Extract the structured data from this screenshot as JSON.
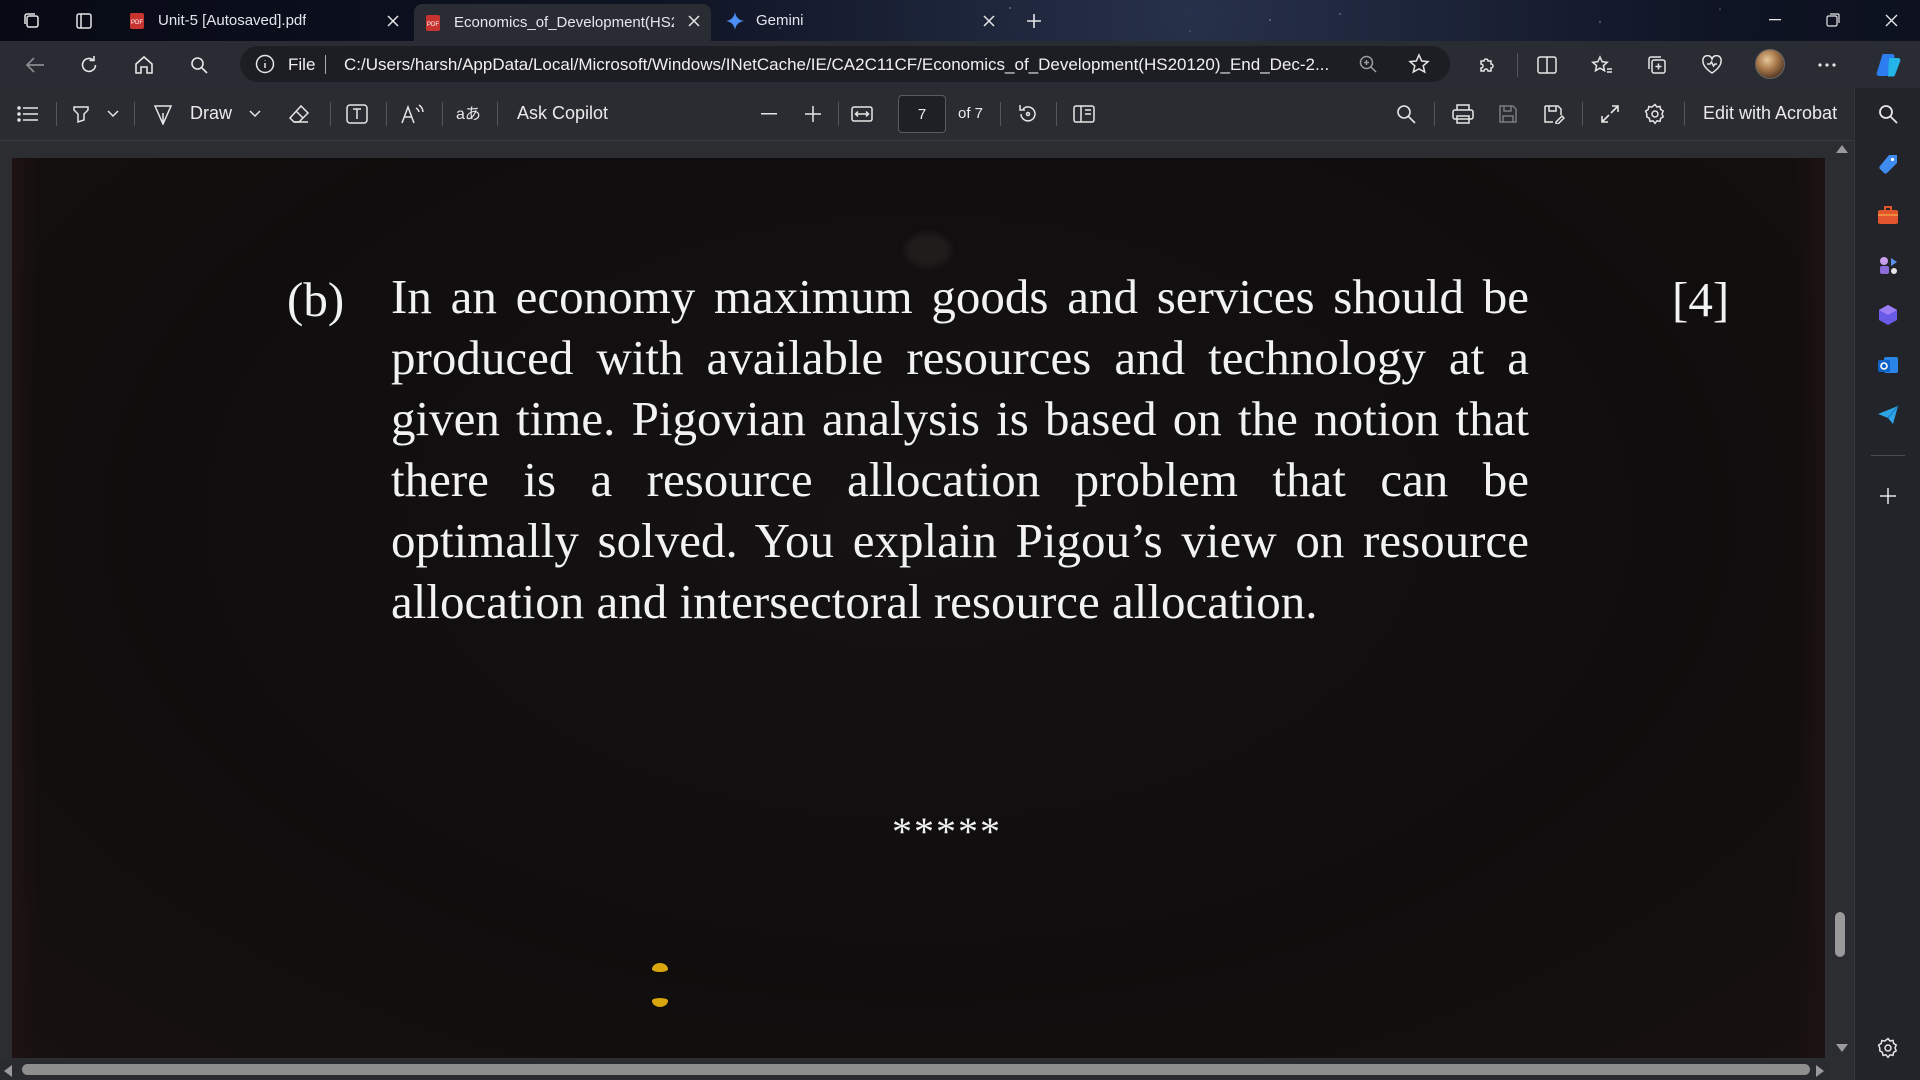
{
  "browser": {
    "tabs": [
      {
        "label": "Unit-5 [Autosaved].pdf",
        "active": false
      },
      {
        "label": "Economics_of_Development(HS2",
        "active": true
      },
      {
        "label": "Gemini",
        "active": false
      }
    ],
    "address": {
      "scheme_label": "File",
      "url": "C:/Users/harsh/AppData/Local/Microsoft/Windows/INetCache/IE/CA2C11CF/Economics_of_Development(HS20120)_End_Dec-2..."
    }
  },
  "pdf_toolbar": {
    "draw_label": "Draw",
    "copilot_label": "Ask Copilot",
    "page_current": "7",
    "page_total_label": "of 7",
    "edit_label": "Edit with Acrobat"
  },
  "document": {
    "question_label": "(b)",
    "question_text": "In an economy maximum goods and services should be produced with available resources and technology at a given time. Pigovian analysis is based on the notion that there is a resource allocation problem that can be optimally solved.  You explain Pigou’s view on resource allocation and intersectoral resource allocation.",
    "marks": "[4]",
    "end_marker": "*****"
  },
  "colors": {
    "accent": "#1d90f5",
    "pdf_icon_red": "#c7332f",
    "marker_yellow": "#d9a60d"
  }
}
